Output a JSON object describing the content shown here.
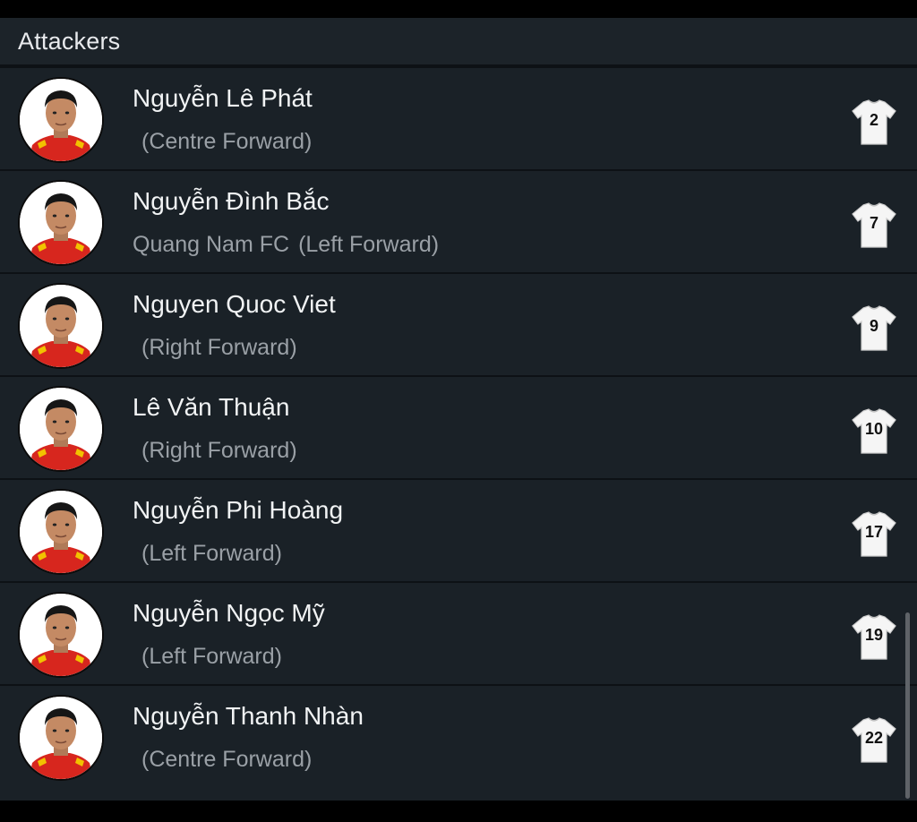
{
  "section": {
    "title": "Attackers"
  },
  "players": [
    {
      "name": "Nguyễn Lê Phát",
      "club": "",
      "position": "(Centre Forward)",
      "number": "2"
    },
    {
      "name": "Nguyễn Đình Bắc",
      "club": "Quang Nam FC",
      "position": "(Left Forward)",
      "number": "7"
    },
    {
      "name": "Nguyen Quoc Viet",
      "club": "",
      "position": "(Right Forward)",
      "number": "9"
    },
    {
      "name": "Lê Văn Thuận",
      "club": "",
      "position": "(Right Forward)",
      "number": "10"
    },
    {
      "name": "Nguyễn Phi Hoàng",
      "club": "",
      "position": "(Left Forward)",
      "number": "17"
    },
    {
      "name": "Nguyễn Ngọc Mỹ",
      "club": "",
      "position": "(Left Forward)",
      "number": "19"
    },
    {
      "name": "Nguyễn Thanh Nhàn",
      "club": "",
      "position": "(Centre Forward)",
      "number": "22"
    }
  ],
  "colors": {
    "background": "#1a2127",
    "divider": "#0d1115",
    "name_text": "#f1f3f4",
    "secondary_text": "#9aa0a6",
    "kit_red": "#d7261e",
    "kit_yellow": "#f2c200"
  },
  "icons": {
    "avatar": "player-photo",
    "jersey": "jersey-icon"
  }
}
